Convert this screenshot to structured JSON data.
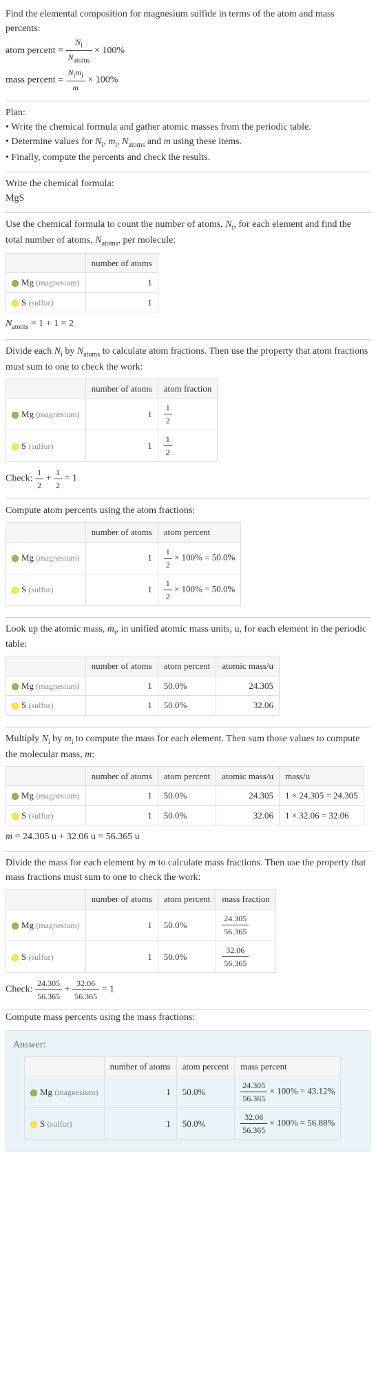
{
  "intro": {
    "l1": "Find the elemental composition for magnesium sulfide in terms of the atom and mass percents:",
    "ap_lhs": "atom percent = ",
    "ap_n": "N",
    "ap_i": "i",
    "ap_den": "N",
    "ap_atoms": "atoms",
    "ap_rhs": " × 100%",
    "mp_lhs": "mass percent = ",
    "mp_n": "N",
    "mp_i": "i",
    "mp_m": "m",
    "mp_den": "m",
    "mp_rhs": " × 100%"
  },
  "plan": {
    "title": "Plan:",
    "b1": "• Write the chemical formula and gather atomic masses from the periodic table.",
    "b2_a": "• Determine values for ",
    "b2_ni": "N",
    "b2_i": "i",
    "b2_mi": "m",
    "b2_mid": ", ",
    "b2_na": "N",
    "b2_atoms": "atoms",
    "b2_and": " and ",
    "b2_m": "m",
    "b2_end": " using these items.",
    "b3": "• Finally, compute the percents and check the results."
  },
  "cf": {
    "title": "Write the chemical formula:",
    "formula": "MgS"
  },
  "count": {
    "text_a": "Use the chemical formula to count the number of atoms, ",
    "ni": "N",
    "i": "i",
    "text_b": ", for each element and find the total number of atoms, ",
    "na": "N",
    "atoms": "atoms",
    "text_c": ", per molecule:",
    "col1": "",
    "col2": "number of atoms",
    "mg": "Mg",
    "mg_paren": "(magnesium)",
    "mg_n": "1",
    "s": "S",
    "s_paren": "(sulfur)",
    "s_n": "1",
    "total_a": "N",
    "total_atoms": "atoms",
    "total_eq": " = 1 + 1 = 2"
  },
  "afrac": {
    "text_a": "Divide each ",
    "ni": "N",
    "i": "i",
    "text_b": " by ",
    "na": "N",
    "atoms": "atoms",
    "text_c": " to calculate atom fractions. Then use the property that atom fractions must sum to one to check the work:",
    "col2": "number of atoms",
    "col3": "atom fraction",
    "mg_n": "1",
    "mg_fn": "1",
    "mg_fd": "2",
    "s_n": "1",
    "s_fn": "1",
    "s_fd": "2",
    "check_a": "Check: ",
    "c1n": "1",
    "c1d": "2",
    "plus": " + ",
    "c2n": "1",
    "c2d": "2",
    "eq": " = 1"
  },
  "apct": {
    "title": "Compute atom percents using the atom fractions:",
    "col2": "number of atoms",
    "col3": "atom percent",
    "mg_n": "1",
    "mg_fn": "1",
    "mg_fd": "2",
    "mg_r": " × 100% = 50.0%",
    "s_n": "1",
    "s_fn": "1",
    "s_fd": "2",
    "s_r": " × 100% = 50.0%"
  },
  "amass": {
    "text_a": "Look up the atomic mass, ",
    "mi": "m",
    "i": "i",
    "text_b": ", in unified atomic mass units, u, for each element in the periodic table:",
    "col2": "number of atoms",
    "col3": "atom percent",
    "col4": "atomic mass/u",
    "mg_n": "1",
    "mg_p": "50.0%",
    "mg_m": "24.305",
    "s_n": "1",
    "s_p": "50.0%",
    "s_m": "32.06"
  },
  "molmass": {
    "text_a": "Multiply ",
    "ni": "N",
    "i": "i",
    "text_b": " by ",
    "mi": "m",
    "text_c": " to compute the mass for each element. Then sum those values to compute the molecular mass, ",
    "m": "m",
    "text_d": ":",
    "col2": "number of atoms",
    "col3": "atom percent",
    "col4": "atomic mass/u",
    "col5": "mass/u",
    "mg_n": "1",
    "mg_p": "50.0%",
    "mg_am": "24.305",
    "mg_mu": "1 × 24.305 = 24.305",
    "s_n": "1",
    "s_p": "50.0%",
    "s_am": "32.06",
    "s_mu": "1 × 32.06 = 32.06",
    "tot_a": "m",
    "tot_b": " = 24.305 u + 32.06 u = 56.365 u"
  },
  "mfrac": {
    "text": "Divide the mass for each element by ",
    "m": "m",
    "text_b": " to calculate mass fractions. Then use the property that mass fractions must sum to one to check the work:",
    "col2": "number of atoms",
    "col3": "atom percent",
    "col4": "mass fraction",
    "mg_n": "1",
    "mg_p": "50.0%",
    "mg_fn": "24.305",
    "mg_fd": "56.365",
    "s_n": "1",
    "s_p": "50.0%",
    "s_fn": "32.06",
    "s_fd": "56.365",
    "check_a": "Check: ",
    "c1n": "24.305",
    "c1d": "56.365",
    "plus": " + ",
    "c2n": "32.06",
    "c2d": "56.365",
    "eq": " = 1"
  },
  "final": {
    "title": "Compute mass percents using the mass fractions:",
    "ans": "Answer:",
    "col2": "number of atoms",
    "col3": "atom percent",
    "col4": "mass percent",
    "mg_n": "1",
    "mg_p": "50.0%",
    "mg_fn": "24.305",
    "mg_fd": "56.365",
    "mg_r": " × 100% = 43.12%",
    "s_n": "1",
    "s_p": "50.0%",
    "s_fn": "32.06",
    "s_fd": "56.365",
    "s_r": " × 100% = 56.88%"
  },
  "chart_data": {
    "type": "table",
    "title": "Elemental composition of MgS",
    "columns": [
      "element",
      "number_of_atoms",
      "atom_fraction",
      "atom_percent",
      "atomic_mass_u",
      "mass_u",
      "mass_fraction",
      "mass_percent"
    ],
    "rows": [
      {
        "element": "Mg",
        "number_of_atoms": 1,
        "atom_fraction": 0.5,
        "atom_percent": 50.0,
        "atomic_mass_u": 24.305,
        "mass_u": 24.305,
        "mass_fraction": 0.4312,
        "mass_percent": 43.12
      },
      {
        "element": "S",
        "number_of_atoms": 1,
        "atom_fraction": 0.5,
        "atom_percent": 50.0,
        "atomic_mass_u": 32.06,
        "mass_u": 32.06,
        "mass_fraction": 0.5688,
        "mass_percent": 56.88
      }
    ],
    "totals": {
      "N_atoms": 2,
      "molecular_mass_u": 56.365
    }
  }
}
